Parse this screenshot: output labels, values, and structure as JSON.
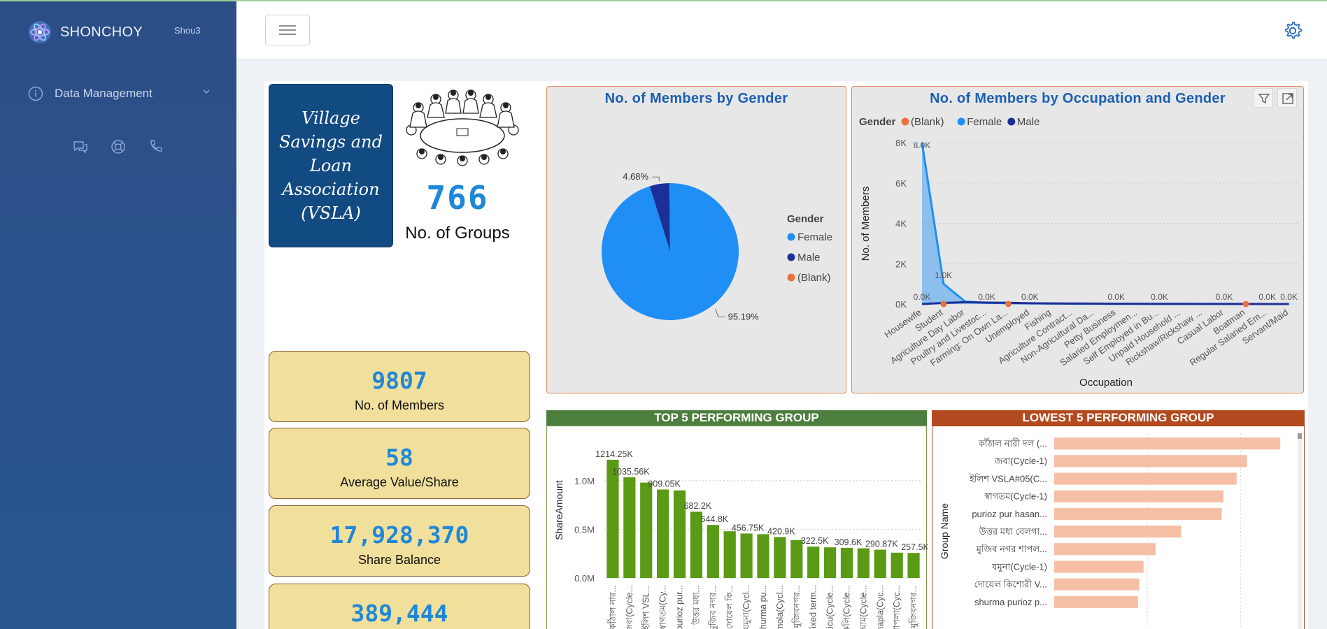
{
  "sidebar": {
    "brand_name": "SHONCHOY",
    "user": "Shou3",
    "nav_label": "Data Management",
    "icons": [
      "chat-icon",
      "support-icon",
      "phone-icon"
    ]
  },
  "header": {
    "menu_icon": "hamburger-icon",
    "settings_icon": "gear-icon"
  },
  "vsla": {
    "title_lines": [
      "Village",
      "Savings and",
      "Loan",
      "Association",
      "(VSLA)"
    ]
  },
  "kpis": {
    "groups_value": "766",
    "groups_label": "No. of Groups",
    "members_value": "9807",
    "members_label": "No. of Members",
    "avg_value": "58",
    "avg_label": "Average Value/Share",
    "share_value": "17,928,370",
    "share_label": "Share Balance",
    "fourth_value": "389,444"
  },
  "colors": {
    "female": "#1f8ff5",
    "male": "#1c2f99",
    "blank": "#e9733f",
    "green_bar": "#5b9a14",
    "red_bar": "#f5bfa6",
    "accent_blue": "#1a5fb4"
  },
  "chart_data": [
    {
      "type": "pie",
      "title": "No. of Members by Gender",
      "legend_title": "Gender",
      "legend_position": "right",
      "labels": [
        "Female",
        "Male",
        "(Blank)"
      ],
      "values": [
        95.19,
        4.68,
        0.13
      ],
      "value_labels": [
        "95.19%",
        "4.68%"
      ]
    },
    {
      "type": "area",
      "title": "No. of Members by Occupation and Gender",
      "legend_title": "Gender",
      "legend_position": "top-left",
      "xlabel": "Occupation",
      "ylabel": "No. of Members",
      "ylim": [
        0,
        8000
      ],
      "yticks": [
        "0K",
        "2K",
        "4K",
        "6K",
        "8K"
      ],
      "categories": [
        "Housewife",
        "Student",
        "Agriculture Day Labor",
        "Poultry and Livestoc...",
        "Farming: On Own La...",
        "Unemployed",
        "Fishing",
        "Agriculture Contract...",
        "Non-Agricultural Da...",
        "Petty Business",
        "Salaried Employmen...",
        "Self Employed in Bu...",
        "Unpaid Household ...",
        "Rickshaw/Rickshaw ...",
        "Casual Labor",
        "Boatman",
        "Regular Salaried Em...",
        "Servant/Maid"
      ],
      "series": [
        {
          "name": "Female",
          "values": [
            8000,
            1000,
            120,
            60,
            40,
            30,
            20,
            15,
            12,
            10,
            8,
            6,
            5,
            4,
            3,
            2,
            2,
            1
          ]
        },
        {
          "name": "Male",
          "values": [
            0,
            50,
            90,
            70,
            60,
            40,
            30,
            25,
            20,
            15,
            12,
            10,
            8,
            6,
            5,
            3,
            2,
            1
          ]
        },
        {
          "name": "(Blank)",
          "values": [
            0,
            0,
            0,
            0,
            0,
            0,
            0,
            0,
            0,
            0,
            0,
            0,
            0,
            0,
            0,
            0,
            0,
            0
          ]
        }
      ],
      "data_labels": [
        {
          "category": "Housewife",
          "text": "8.0K"
        },
        {
          "category": "Housewife",
          "text": "0.0K"
        },
        {
          "category": "Student",
          "text": "1.0K"
        },
        {
          "category": "Poultry and Livestoc...",
          "text": "0.0K"
        },
        {
          "category": "Unemployed",
          "text": "0.0K"
        },
        {
          "category": "Petty Business",
          "text": "0.0K"
        },
        {
          "category": "Self Employed in Bu...",
          "text": "0.0K"
        },
        {
          "category": "Casual Labor",
          "text": "0.0K"
        },
        {
          "category": "Regular Salaried Em...",
          "text": "0.0K"
        },
        {
          "category": "Servant/Maid",
          "text": "0.0K"
        }
      ]
    },
    {
      "type": "bar",
      "title": "TOP 5 PERFORMING GROUP",
      "ylabel": "ShareAmount",
      "ylim": [
        0,
        1300000
      ],
      "yticks": [
        "0.0M",
        "0.5M",
        "1.0M"
      ],
      "categories": [
        "কাঁঠাল নার...",
        "জবা(Cycle...",
        "ইলিশ VSL...",
        "স্বাগতম(Cy...",
        "purioz pur...",
        "উত্তর মধ্য...",
        "মুজিব নগর...",
        "দোয়েল কি...",
        "যমুনা(Cycl...",
        "shurma pu...",
        "mola(Cycl...",
        "মুজিবনগর...",
        "Fixed term...",
        "Licu(Cycle...",
        "কলি(Cycle...",
        "আম(Cycle...",
        "shapla(Cyc...",
        "শাপলা(Cyc...",
        "মুজিবনগর..."
      ],
      "values": [
        1214250,
        1035560,
        980000,
        909050,
        900000,
        682200,
        544800,
        480000,
        456750,
        450000,
        420900,
        390000,
        322500,
        315000,
        309600,
        305000,
        290870,
        260000,
        257500
      ],
      "data_labels": [
        "1214.25K",
        "1035.56K",
        "",
        "909.05K",
        "",
        "682.2K",
        "544.8K",
        "",
        "456.75K",
        "",
        "420.9K",
        "",
        "322.5K",
        "",
        "309.6K",
        "",
        "290.87K",
        "",
        "257.5K"
      ]
    },
    {
      "type": "bar",
      "orientation": "horizontal",
      "title": "LOWEST 5 PERFORMING GROUP",
      "ylabel": "Group Name",
      "categories": [
        "কাঁঠাল নারী দল (...",
        "জবা(Cycle-1)",
        "ইলিশ VSLA#05(C...",
        "স্বাগতম(Cycle-1)",
        "purioz pur hasan...",
        "উত্তর মধ্য বেলগা...",
        "মুজিব নগর শাপল...",
        "যমুনা(Cycle-1)",
        "দোয়েল কিশোরী V...",
        "shurma purioz p..."
      ],
      "values": [
        1214250,
        1035560,
        980000,
        909050,
        900000,
        682200,
        544800,
        480000,
        456750,
        450000
      ],
      "xlim": [
        0,
        1300000
      ]
    }
  ]
}
